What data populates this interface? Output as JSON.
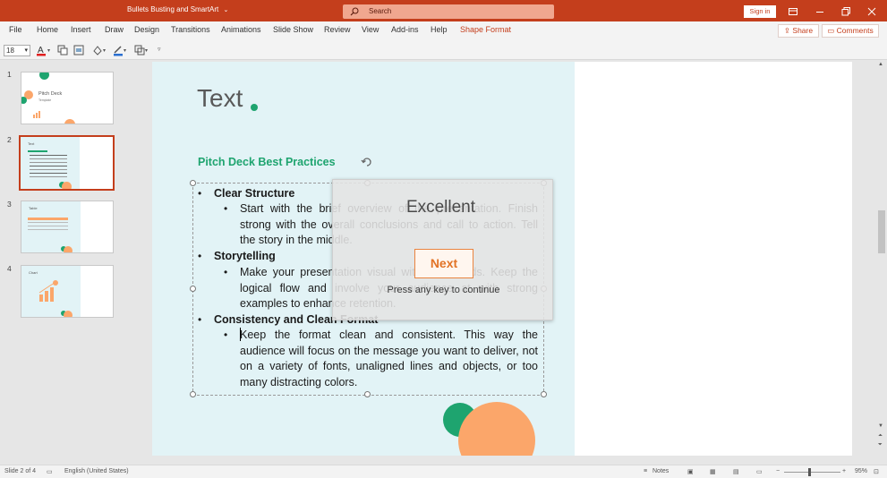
{
  "app": {
    "title": "Bullets Busting and SmartArt",
    "title_chevron": "⌄",
    "search_placeholder": "Search",
    "sign_in": "Sign in"
  },
  "menu": {
    "items": [
      "File",
      "Home",
      "Insert",
      "Draw",
      "Design",
      "Transitions",
      "Animations",
      "Slide Show",
      "Review",
      "View",
      "Add-ins",
      "Help",
      "Shape Format"
    ],
    "share": "Share",
    "comments": "Comments"
  },
  "toolbar": {
    "font_size": "18"
  },
  "thumbnails": [
    {
      "number": "1",
      "title": "Pitch Deck",
      "subtitle": "Template"
    },
    {
      "number": "2",
      "title": "Text",
      "subtitle": ""
    },
    {
      "number": "3",
      "title": "Table",
      "subtitle": ""
    },
    {
      "number": "4",
      "title": "Chart",
      "subtitle": ""
    }
  ],
  "slide": {
    "title": "Text",
    "subtitle": "Pitch Deck Best Practices",
    "bullets": [
      {
        "heading": "Clear Structure",
        "body": "Start with the brief overview of the presentation. Finish strong with the overall conclusions and call to action. Tell the story in the middle."
      },
      {
        "heading": "Storytelling",
        "body": "Make your presentation visual with less words. Keep the logical flow and involve your audience at with strong examples to enhance retention."
      },
      {
        "heading": "Consistency and Clean Format",
        "body": "Keep the format clean and consistent. This way the audience will focus on the message you want to deliver, not on a variety of fonts, unaligned lines and objects, or too many distracting colors."
      }
    ]
  },
  "popup": {
    "title": "Excellent",
    "button": "Next",
    "hint": "Press any key to continue"
  },
  "status": {
    "slide_info": "Slide 2 of 4",
    "language": "English (United States)",
    "notes": "Notes",
    "zoom": "95%"
  },
  "colors": {
    "accent": "#c43e1c",
    "green": "#1ea46f",
    "orange": "#fba66a"
  }
}
